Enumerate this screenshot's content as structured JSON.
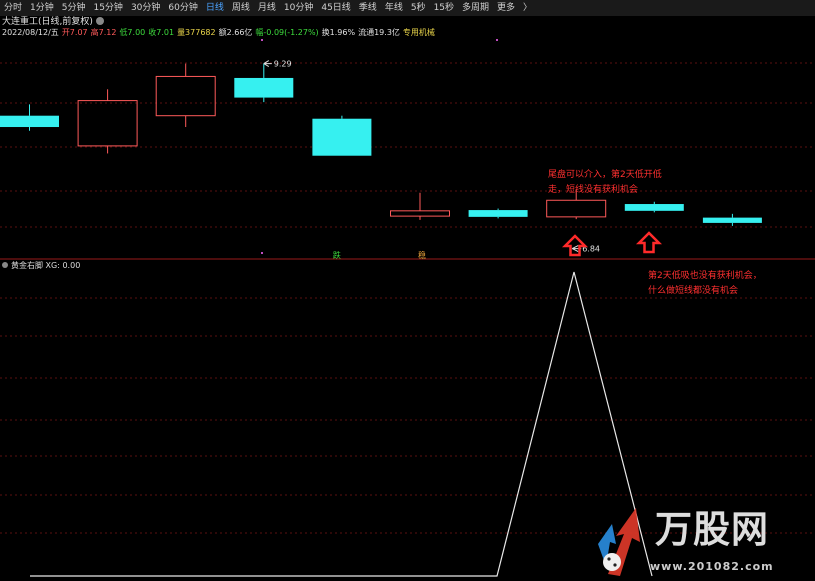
{
  "toolbar": {
    "tabs": [
      "分时",
      "1分钟",
      "5分钟",
      "15分钟",
      "30分钟",
      "60分钟",
      "日线",
      "周线",
      "月线",
      "10分钟",
      "45日线",
      "季线",
      "年线",
      "5秒",
      "15秒",
      "多周期",
      "更多"
    ],
    "active_index": 6,
    "more_arrow": "〉"
  },
  "stock": {
    "title": "大连重工(日线,前复权)",
    "gear_icon": "gear-icon"
  },
  "info": {
    "date": "2022/08/12/五",
    "open": "开7.07",
    "high": "高7.12",
    "low": "低7.00",
    "close": "收7.01",
    "volume": "量377682",
    "amount": "额2.66亿",
    "change": "幅-0.09(-1.27%)",
    "turnover": "换1.96%",
    "float_cap": "流通19.3亿",
    "sector": "专用机械"
  },
  "colors": {
    "up": "#ff5a5a",
    "down": "#36f0f0",
    "grid": "#5a1010",
    "divider": "#9a1a1a",
    "annotation": "#ff3030",
    "indicator_line": "#e8e8e8"
  },
  "chart_data": [
    {
      "type": "candlestick",
      "title": "大连重工(日线,前复权)",
      "candles": [
        {
          "direction": "down",
          "open": 8.6,
          "close": 8.45,
          "high": 8.75,
          "low": 8.4
        },
        {
          "direction": "up",
          "open": 8.2,
          "close": 8.8,
          "high": 8.95,
          "low": 8.1
        },
        {
          "direction": "up",
          "open": 8.6,
          "close": 9.12,
          "high": 9.29,
          "low": 8.45
        },
        {
          "direction": "down",
          "open": 9.1,
          "close": 8.84,
          "high": 9.29,
          "low": 8.78
        },
        {
          "direction": "down",
          "open": 8.56,
          "close": 8.07,
          "high": 8.6,
          "low": 8.07
        },
        {
          "direction": "up",
          "open": 7.27,
          "close": 7.34,
          "high": 7.58,
          "low": 7.22
        },
        {
          "direction": "down",
          "open": 7.35,
          "close": 7.26,
          "high": 7.37,
          "low": 7.24
        },
        {
          "direction": "up",
          "open": 7.26,
          "close": 7.48,
          "high": 7.62,
          "low": 7.23
        },
        {
          "direction": "down",
          "open": 7.43,
          "close": 7.34,
          "high": 7.46,
          "low": 7.32
        },
        {
          "direction": "down",
          "open": 7.25,
          "close": 7.18,
          "high": 7.3,
          "low": 7.14
        }
      ],
      "high_label": "9.29",
      "low_label": "6.84",
      "markers": [
        {
          "candle": 4,
          "text": "跌"
        },
        {
          "candle": 5,
          "text": "稳"
        }
      ]
    },
    {
      "type": "line",
      "title": "黄金右脚",
      "series": [
        {
          "name": "XG",
          "values": [
            0,
            0,
            0,
            0,
            0,
            0,
            0,
            0,
            0,
            0,
            0,
            0,
            0,
            0,
            0,
            0,
            0,
            0,
            0,
            0,
            0,
            0,
            0,
            1,
            0
          ]
        }
      ],
      "current_value": "0.00"
    }
  ],
  "indicator": {
    "name": "黄金右脚",
    "value_label": "XG: 0.00"
  },
  "annotations": {
    "note1": "尾盘可以介入，第2天低开低走，短线没有获利机会",
    "note2": "第2天低吸也没有获利机会，什么做短线都没有机会"
  },
  "watermark": {
    "text": "万股网",
    "url": "www.201082.com"
  }
}
